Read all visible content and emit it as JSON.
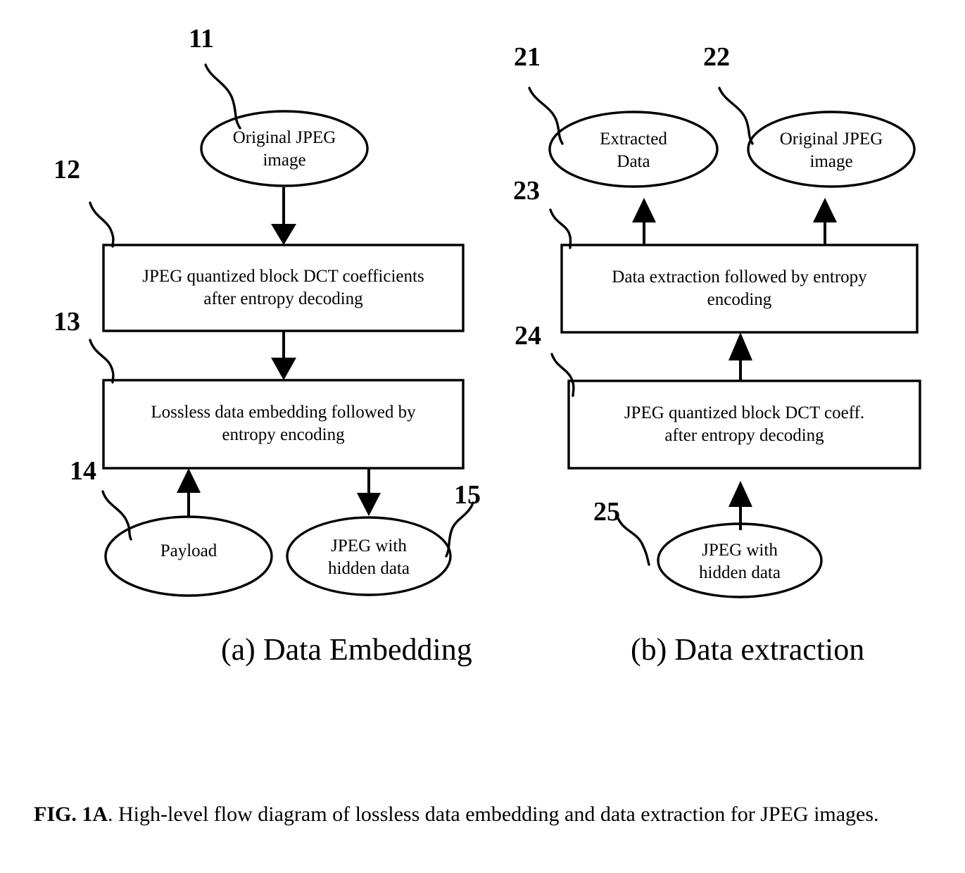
{
  "figure": {
    "caption_label": "FIG. 1A",
    "caption_text": ". High-level flow diagram of lossless data embedding and data extraction for JPEG images."
  },
  "panels": [
    {
      "id": "panel-a",
      "caption": "(a) Data Embedding"
    },
    {
      "id": "panel-b",
      "caption": "(b) Data extraction"
    }
  ],
  "embedding": {
    "ref_11": "11",
    "ref_12": "12",
    "ref_13": "13",
    "ref_14": "14",
    "ref_15": "15",
    "node_11": "Original JPEG\nimage",
    "node_12": "JPEG quantized block DCT coefficients\nafter entropy decoding",
    "node_13": "Lossless data embedding followed by\nentropy encoding",
    "node_14": "Payload",
    "node_15": "JPEG with\nhidden data"
  },
  "extraction": {
    "ref_21": "21",
    "ref_22": "22",
    "ref_23": "23",
    "ref_24": "24",
    "ref_25": "25",
    "node_21": "Extracted\nData",
    "node_22": "Original JPEG\nimage",
    "node_23": "Data extraction followed by entropy\nencoding",
    "node_24": "JPEG quantized block DCT coeff.\nafter entropy decoding",
    "node_25": "JPEG with\nhidden data"
  },
  "style": {
    "stroke": "#000000",
    "background": "#ffffff"
  }
}
